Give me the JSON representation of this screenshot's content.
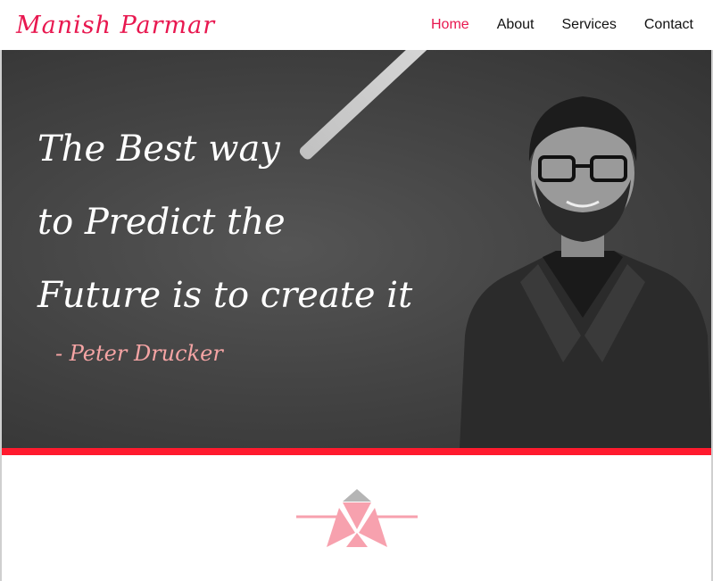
{
  "header": {
    "brand": "Manish Parmar",
    "nav": [
      {
        "label": "Home",
        "active": true
      },
      {
        "label": "About",
        "active": false
      },
      {
        "label": "Services",
        "active": false
      },
      {
        "label": "Contact",
        "active": false
      }
    ]
  },
  "hero": {
    "quote_lines": [
      "The Best way",
      "to  Predict  the",
      "Future is to create it"
    ],
    "author": "- Peter Drucker",
    "portrait": "man-in-dark-suit-with-glasses"
  },
  "colors": {
    "accent": "#e8174f",
    "bar": "#ff1a2e",
    "emblem_pink": "#f7a1ae",
    "emblem_gray": "#b5b5b5"
  },
  "icons": {
    "section_divider": "diamond-emblem-icon"
  }
}
